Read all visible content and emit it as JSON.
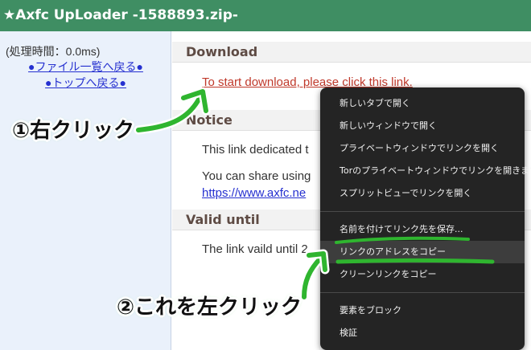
{
  "window": {
    "title": "★Axfc UpLoader -1588893.zip-"
  },
  "sidebar": {
    "time": "(処理時間：0.0ms)",
    "links": [
      "●ファイル一覧へ戻る●",
      "●トップへ戻る●"
    ]
  },
  "main": {
    "download": {
      "heading": "Download",
      "link": "To start download, please click this link."
    },
    "notice": {
      "heading": "Notice",
      "text": "This link dedicated t",
      "share": "You can share using",
      "url": "https://www.axfc.ne"
    },
    "valid": {
      "heading": "Valid until",
      "text": "The link vaild until 2"
    }
  },
  "context_menu": {
    "items": [
      "新しいタブで開く",
      "新しいウィンドウで開く",
      "プライベートウィンドウでリンクを開く",
      "Torのプライベートウィンドウでリンクを開きます",
      "スプリットビューでリンクを開く",
      "名前を付けてリンク先を保存...",
      "リンクのアドレスをコピー",
      "クリーンリンクをコピー",
      "要素をブロック",
      "検証"
    ],
    "highlighted_index": 6
  },
  "annotations": {
    "step1": "①右クリック",
    "step2": "②これを左クリック",
    "color": "#2fb52f"
  }
}
